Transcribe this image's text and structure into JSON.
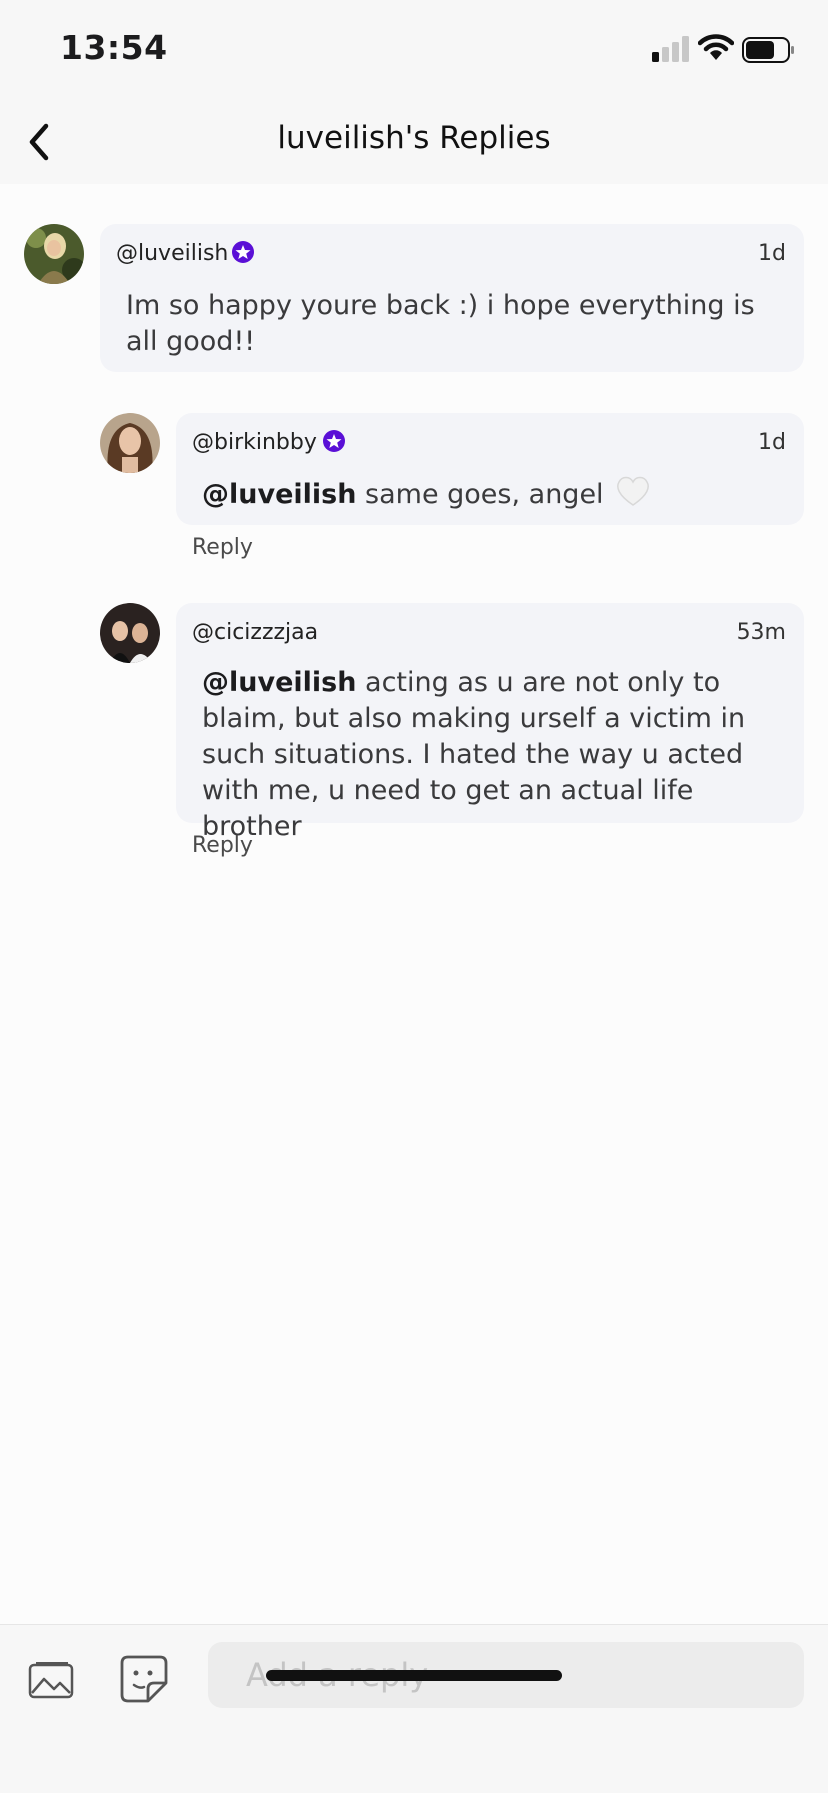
{
  "status_bar": {
    "time": "13:54"
  },
  "nav": {
    "title": "luveilish's Replies",
    "back_icon": "chevron-left-icon"
  },
  "thread": {
    "parent": {
      "username": "@luveilish",
      "verified": true,
      "time": "1d",
      "text": "Im so happy youre back :) i hope everything is all good!!"
    },
    "replies": [
      {
        "username": "@birkinbby",
        "verified": true,
        "time": "1d",
        "mention": "@luveilish",
        "text": " same goes, angel",
        "emoji": "white-heart",
        "reply_label": "Reply"
      },
      {
        "username": "@cicizzzjaa",
        "verified": false,
        "time": "53m",
        "mention": "@luveilish",
        "text": " acting as u are not only to blaim, but also making urself a victim in such situations. I hated the way u acted with me, u need to get an actual life brother",
        "reply_label": "Reply"
      }
    ]
  },
  "composer": {
    "placeholder": "Add a reply",
    "image_icon": "image-icon",
    "sticker_icon": "sticker-icon"
  },
  "colors": {
    "verified_badge": "#5a0fd6",
    "bubble_bg": "#f3f4f8",
    "input_bg": "#ececec"
  }
}
